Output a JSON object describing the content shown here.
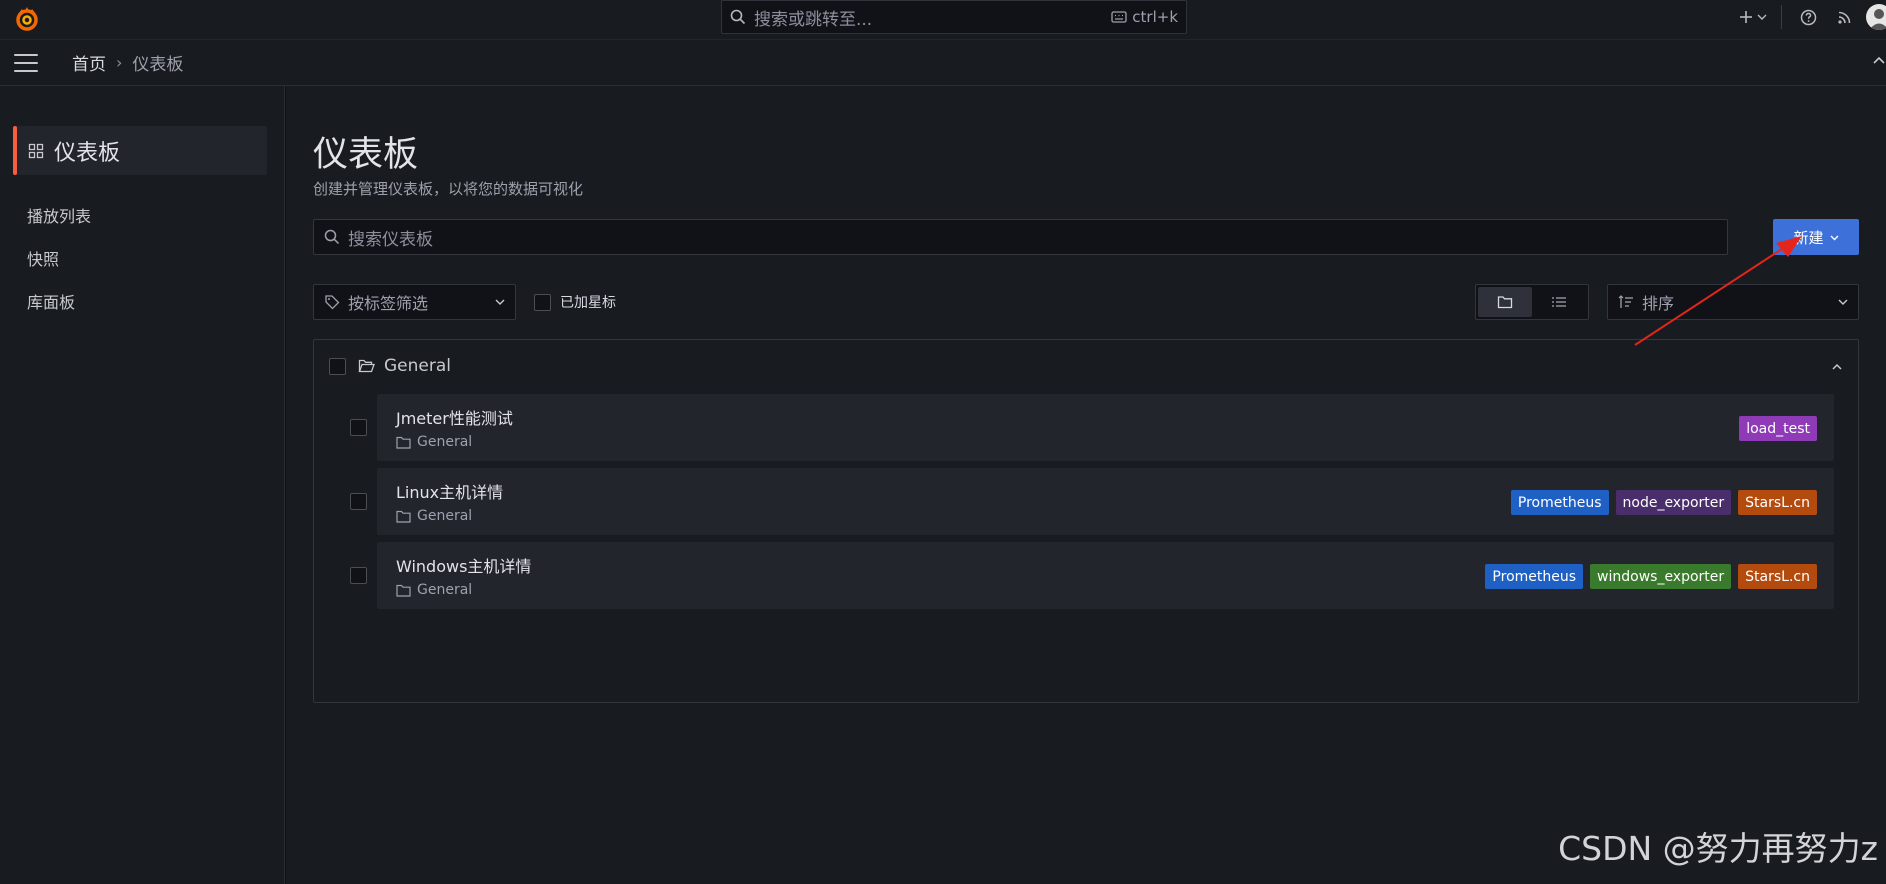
{
  "topbar": {
    "search_placeholder": "搜索或跳转至...",
    "shortcut": "ctrl+k",
    "icons": [
      "grafana-logo-icon",
      "search-icon",
      "keyboard-icon",
      "plus-icon",
      "chevron-down-icon",
      "help-icon",
      "rss-icon",
      "user-avatar-icon"
    ]
  },
  "navbar": {
    "breadcrumb_home": "首页",
    "breadcrumb_sep": "›",
    "breadcrumb_current": "仪表板"
  },
  "sidebar": {
    "active_label": "仪表板",
    "items": [
      {
        "label": "播放列表"
      },
      {
        "label": "快照"
      },
      {
        "label": "库面板"
      }
    ]
  },
  "main": {
    "title": "仪表板",
    "subtitle": "创建并管理仪表板，以将您的数据可视化",
    "search_placeholder": "搜索仪表板",
    "new_button": "新建",
    "tag_filter_placeholder": "按标签筛选",
    "starred_label": "已加星标",
    "sort_placeholder": "排序",
    "folder": {
      "name": "General",
      "dashboards": [
        {
          "name": "Jmeter性能测试",
          "folder": "General",
          "tags": [
            {
              "label": "load_test",
              "color": "#8f3bb8"
            }
          ]
        },
        {
          "name": "Linux主机详情",
          "folder": "General",
          "tags": [
            {
              "label": "Prometheus",
              "color": "#1f60c4"
            },
            {
              "label": "node_exporter",
              "color": "#4a2e6b"
            },
            {
              "label": "StarsL.cn",
              "color": "#b34a0e"
            }
          ]
        },
        {
          "name": "Windows主机详情",
          "folder": "General",
          "tags": [
            {
              "label": "Prometheus",
              "color": "#1f60c4"
            },
            {
              "label": "windows_exporter",
              "color": "#3a7a2c"
            },
            {
              "label": "StarsL.cn",
              "color": "#b34a0e"
            }
          ]
        }
      ]
    }
  },
  "watermark": "CSDN @努力再努力z",
  "colors": {
    "accent": "#3d71d9",
    "active_bar": "#f55f3e",
    "annotation_arrow": "#e5251b"
  }
}
